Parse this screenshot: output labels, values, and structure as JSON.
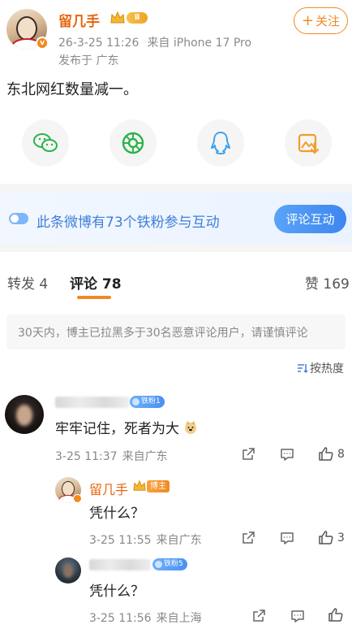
{
  "post": {
    "author": "留几手",
    "level": "Ⅱ",
    "verified_mark": "v",
    "timestamp": "26-3-25 11:26",
    "device": "来自 iPhone 17 Pro",
    "location": "发布于 广东",
    "follow_label": "关注",
    "follow_icon": "plus-icon",
    "text": "东北网红数量减一。"
  },
  "share": [
    {
      "icon": "wechat-icon",
      "color": "#2bb34b"
    },
    {
      "icon": "moments-icon",
      "color": "#2bb34b"
    },
    {
      "icon": "qq-icon",
      "color": "#3ba1f0"
    },
    {
      "icon": "save-image-icon",
      "color": "#f39c2a"
    }
  ],
  "fans_banner": {
    "text": "此条微博有73个铁粉参与互动",
    "button": "评论互动"
  },
  "tabs": {
    "repost": "转发 4",
    "comments": "评论 78",
    "likes": "赞 169"
  },
  "notice": "30天内，博主已拉黑多于30名恶意评论用户，请谨慎评论",
  "sort_label": "按热度",
  "comments": [
    {
      "fan_badge": "铁粉1",
      "text": "牢牢记住，死者为大",
      "emoji": "doge-emoji",
      "time": "3-25 11:37",
      "source": "来自广东",
      "likes": "8"
    }
  ],
  "replies": [
    {
      "author": "留几手",
      "host_label": "博主",
      "text": "凭什么？",
      "time": "3-25 11:55",
      "source": "来自广东",
      "likes": "3"
    },
    {
      "fan_badge": "铁粉5",
      "text": "凭什么？",
      "time": "3-25 11:56",
      "source": "来自上海",
      "likes": ""
    }
  ],
  "colors": {
    "accent": "#f08a24",
    "link_blue": "#3f7fd8",
    "author_orange": "#e8650e"
  }
}
